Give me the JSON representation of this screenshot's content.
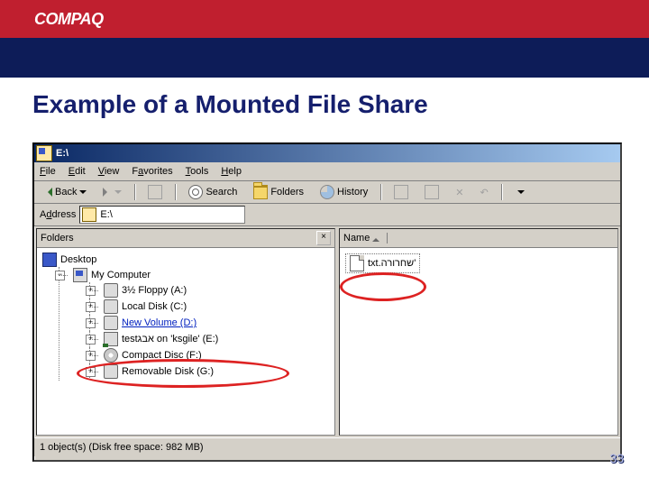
{
  "brand": {
    "logo_text": "COMPAQ"
  },
  "slide": {
    "title": "Example of a Mounted File Share",
    "page_number": "33"
  },
  "window": {
    "title": "E:\\",
    "menu": {
      "file": "File",
      "edit": "Edit",
      "view": "View",
      "favorites": "Favorites",
      "tools": "Tools",
      "help": "Help"
    },
    "toolbar": {
      "back": "Back",
      "search": "Search",
      "folders": "Folders",
      "history": "History"
    },
    "address": {
      "label": "Address",
      "value": "E:\\"
    },
    "folders_pane": {
      "header": "Folders",
      "desktop": "Desktop",
      "my_computer": "My Computer",
      "drives": [
        {
          "label": "3½ Floppy (A:)"
        },
        {
          "label": "Local Disk (C:)"
        },
        {
          "label": "New Volume (D:)",
          "link": true
        },
        {
          "label": "testאבג on 'ksgile' (E:)",
          "net": true
        },
        {
          "label": "Compact Disc (F:)",
          "cd": true
        },
        {
          "label": "Removable Disk (G:)"
        }
      ]
    },
    "content": {
      "col_name": "Name",
      "file": "'שחרורה.txt"
    },
    "status": "1 object(s) (Disk free space: 982 MB)"
  }
}
